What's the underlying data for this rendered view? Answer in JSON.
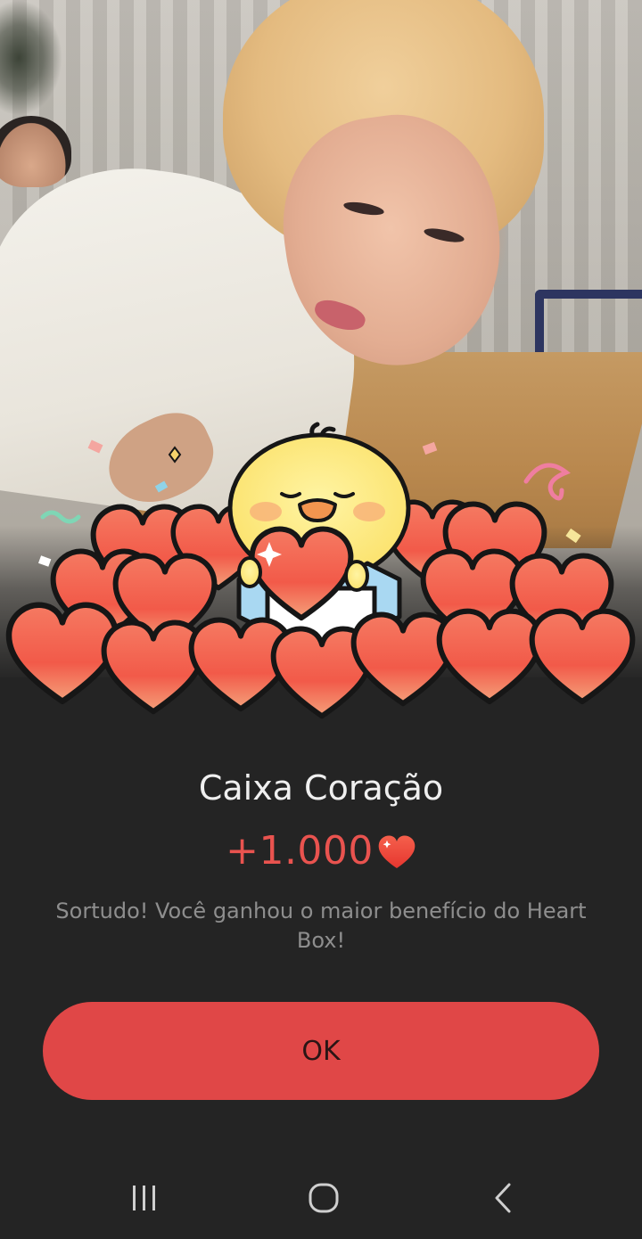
{
  "dialog": {
    "title": "Caixa Coração",
    "reward_amount": "+1.000",
    "reward_icon": "heart-icon",
    "description": "Sortudo! Você ganhou o maior benefício do Heart Box!",
    "ok_label": "OK"
  },
  "nav": {
    "recents_icon": "recents-icon",
    "home_icon": "home-icon",
    "back_icon": "back-icon"
  },
  "colors": {
    "background": "#242424",
    "accent": "#e04747",
    "amount": "#e9534f",
    "title": "#efefef",
    "description": "#8e8e8e"
  }
}
